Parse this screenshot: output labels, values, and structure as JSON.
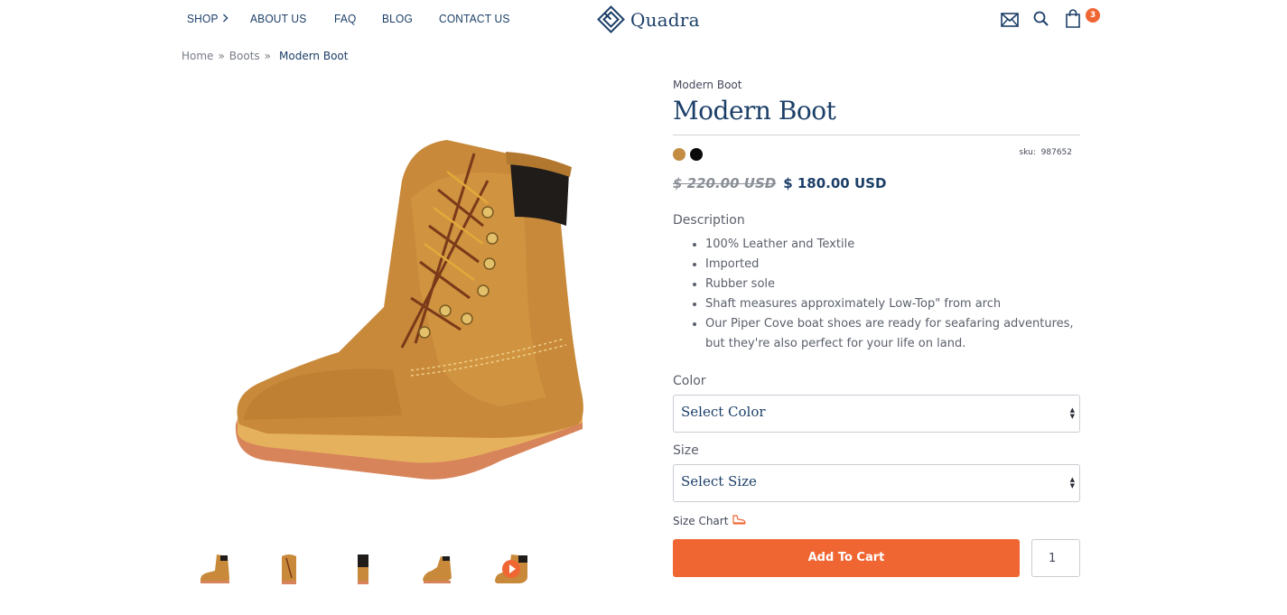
{
  "nav": {
    "items": [
      {
        "label": "SHOP"
      },
      {
        "label": "ABOUT US"
      },
      {
        "label": "FAQ"
      },
      {
        "label": "BLOG"
      },
      {
        "label": "CONTACT US"
      }
    ],
    "logo_text": "Quadra",
    "cart_count": "3",
    "icons": [
      "mail-icon",
      "search-icon",
      "cart-icon"
    ]
  },
  "breadcrumb": {
    "home": "Home",
    "category": "Boots",
    "separator": "»",
    "current": "Modern Boot"
  },
  "product": {
    "vendor": "Modern Boot",
    "title": "Modern Boot",
    "swatches": [
      {
        "name": "tan",
        "color": "#c28c42"
      },
      {
        "name": "black",
        "color": "#0a0a0a"
      }
    ],
    "sku_label": "sku:",
    "sku_value": "987652",
    "old_price": "$ 220.00 USD",
    "new_price": "$ 180.00 USD",
    "description_title": "Description",
    "description_items": [
      "100% Leather and Textile",
      "Imported",
      "Rubber sole",
      "Shaft measures approximately Low-Top\" from arch",
      "Our Piper Cove boat shoes are ready for seafaring adventures, but they're also perfect for your life on land."
    ],
    "color_label": "Color",
    "color_select": "Select Color",
    "size_label": "Size",
    "size_select": "Select Size",
    "size_chart": "Size Chart",
    "add_to_cart": "Add To Cart",
    "quantity": "1",
    "thumbnails": [
      "boot-side",
      "boot-front",
      "boot-back",
      "boot-angle",
      "boot-video"
    ]
  },
  "colors": {
    "brand": "#1c3f68",
    "accent": "#f06633"
  }
}
